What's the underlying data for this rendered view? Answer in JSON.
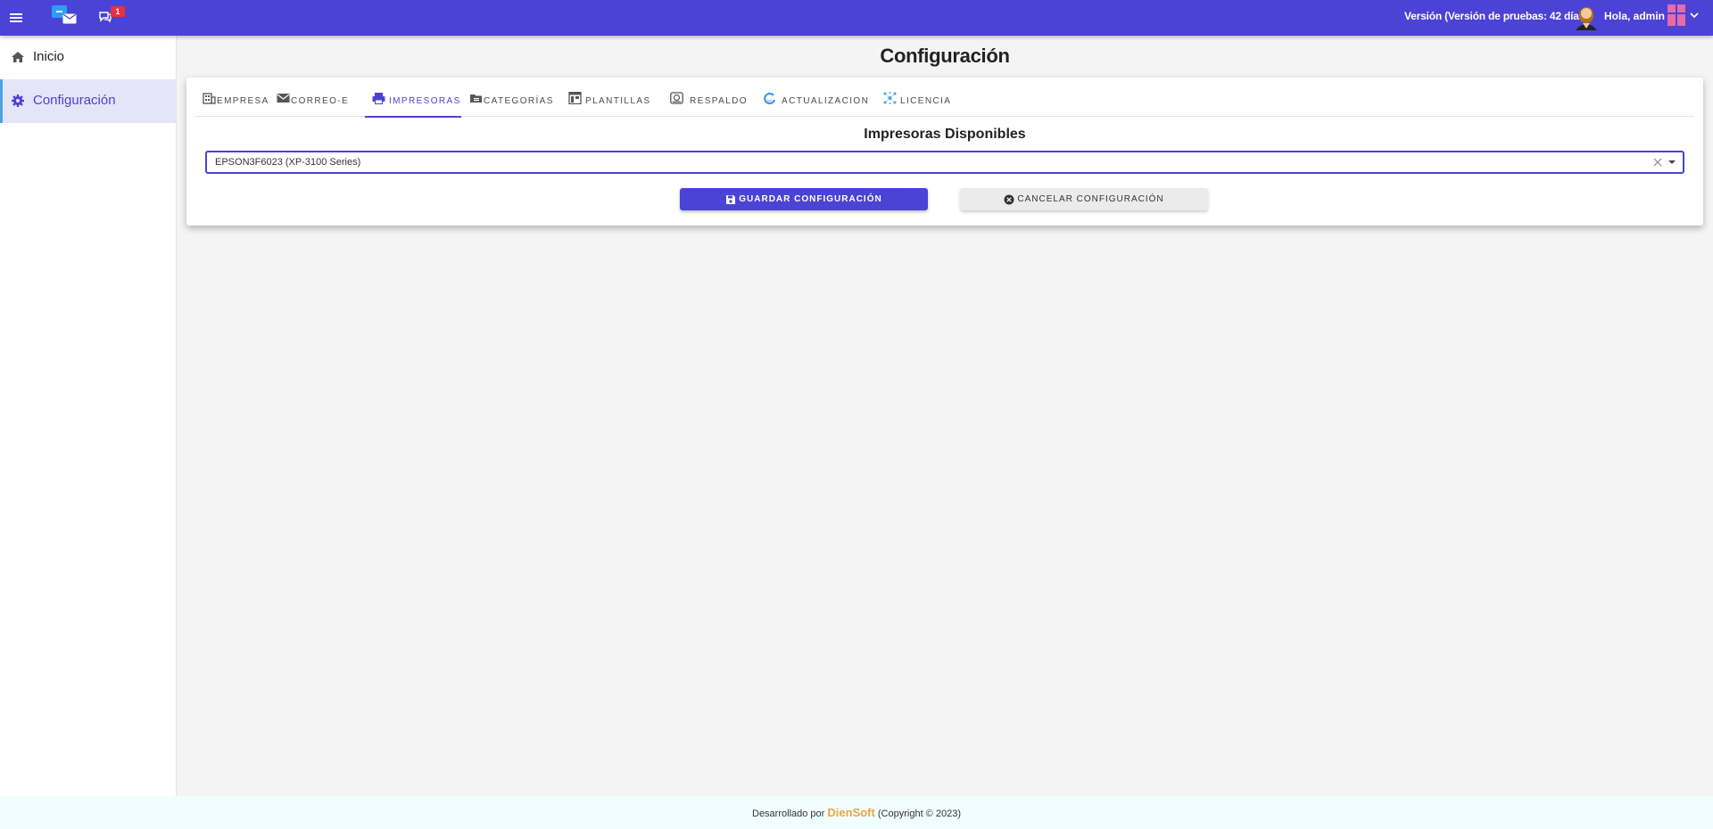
{
  "topbar": {
    "badge_count": "1",
    "version_text": "Versión (Versión de pruebas: 42 días)",
    "greeting": "Hola, admin",
    "accent_color": "#4a43d6"
  },
  "sidebar": {
    "items": [
      {
        "label": "Inicio",
        "icon": "home-icon"
      },
      {
        "label": "Configuración",
        "icon": "gear-icon"
      }
    ]
  },
  "main": {
    "title": "Configuración",
    "tabs": [
      {
        "label": "EMPRESA",
        "icon": "building-icon"
      },
      {
        "label": "CORREO-E",
        "icon": "envelope-icon"
      },
      {
        "label": "IMPRESORAS",
        "icon": "printer-icon"
      },
      {
        "label": "CATEGORÍAS",
        "icon": "folder-icon"
      },
      {
        "label": "PLANTILLAS",
        "icon": "template-icon"
      },
      {
        "label": "RESPALDO",
        "icon": "backup-icon"
      },
      {
        "label": "ACTUALIZACION",
        "icon": "update-icon"
      },
      {
        "label": "LICENCIA",
        "icon": "license-icon"
      }
    ],
    "active_tab": "IMPRESORAS",
    "section_title": "Impresoras Disponibles",
    "printer_select": {
      "value": "EPSON3F6023 (XP-3100 Series)"
    },
    "save_label": "GUARDAR CONFIGURACIÓN",
    "cancel_label": "CANCELAR CONFIGURACIÓN"
  },
  "footer": {
    "prefix": "Desarrollado por ",
    "brand": "DienSoft",
    "suffix": " (Copyright © 2023)"
  }
}
